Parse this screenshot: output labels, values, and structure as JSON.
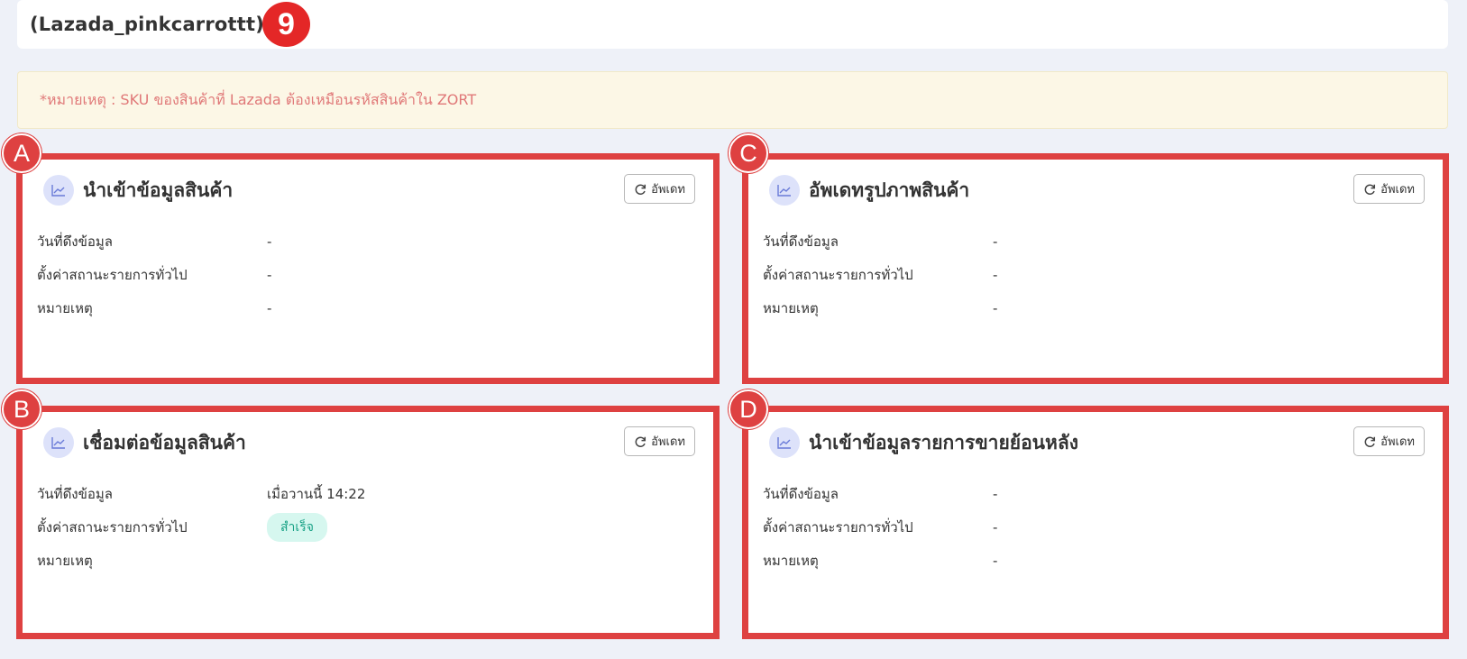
{
  "header": {
    "title": "(Lazada_pinkcarrottt)",
    "step_number": "9"
  },
  "notice": {
    "text": "*หมายเหตุ : SKU ของสินค้าที่ Lazada ต้องเหมือนรหัสสินค้าใน ZORT"
  },
  "colors": {
    "highlight": "#de4141",
    "notice_text": "#e07878",
    "success_bg": "#d6f7ef",
    "success_text": "#17a185",
    "icon_bg": "#dde2fa"
  },
  "cards": {
    "a": {
      "marker": "A",
      "title": "นำเข้าข้อมูลสินค้า",
      "button": "อัพเดท",
      "icon": "chart-line-icon",
      "rows": [
        {
          "key": "วันที่ดึงข้อมูล",
          "value": "-"
        },
        {
          "key": "ตั้งค่าสถานะรายการทั่วไป",
          "value": "-"
        },
        {
          "key": "หมายเหตุ",
          "value": "-"
        }
      ]
    },
    "b": {
      "marker": "B",
      "title": "เชื่อมต่อข้อมูลสินค้า",
      "button": "อัพเดท",
      "icon": "chart-line-icon",
      "rows": [
        {
          "key": "วันที่ดึงข้อมูล",
          "value": "เมื่อวานนี้ 14:22"
        },
        {
          "key": "ตั้งค่าสถานะรายการทั่วไป",
          "value": "สำเร็จ"
        },
        {
          "key": "หมายเหตุ",
          "value": ""
        }
      ]
    },
    "c": {
      "marker": "C",
      "title": "อัพเดทรูปภาพสินค้า",
      "button": "อัพเดท",
      "icon": "chart-line-icon",
      "rows": [
        {
          "key": "วันที่ดึงข้อมูล",
          "value": "-"
        },
        {
          "key": "ตั้งค่าสถานะรายการทั่วไป",
          "value": "-"
        },
        {
          "key": "หมายเหตุ",
          "value": "-"
        }
      ]
    },
    "d": {
      "marker": "D",
      "title": "นำเข้าข้อมูลรายการขายย้อนหลัง",
      "button": "อัพเดท",
      "icon": "chart-line-icon",
      "rows": [
        {
          "key": "วันที่ดึงข้อมูล",
          "value": "-"
        },
        {
          "key": "ตั้งค่าสถานะรายการทั่วไป",
          "value": "-"
        },
        {
          "key": "หมายเหตุ",
          "value": "-"
        }
      ]
    }
  }
}
